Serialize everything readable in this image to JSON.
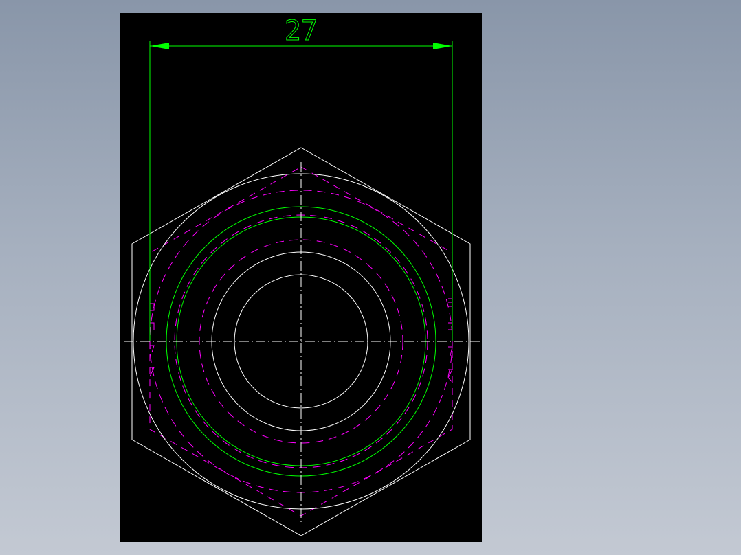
{
  "drawing": {
    "dimension_label": "27",
    "colors": {
      "background": "#000000",
      "outline": "#ffffff",
      "dimension": "#00ff00",
      "thread_circle": "#00ff00",
      "hidden_line": "#ff00ff",
      "center_line": "#ffffff"
    }
  }
}
